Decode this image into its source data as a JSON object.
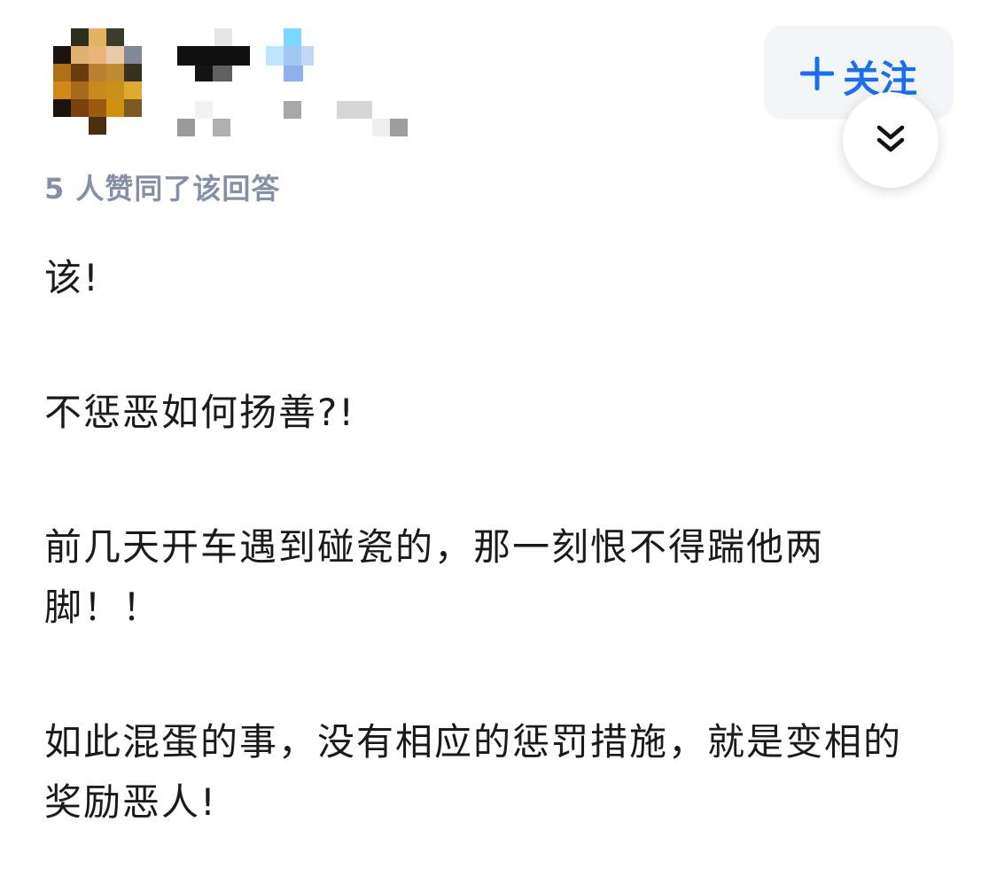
{
  "header": {
    "author_avatar": "avatar (pixelated)",
    "author_name": "",
    "follow_label": "关注",
    "follow_icon": "plus-icon",
    "collapse_icon": "double-chevron-down-icon",
    "colors": {
      "accent": "#1a6ff0",
      "meta_text": "#8590a6",
      "button_bg": "#f4f5f7"
    }
  },
  "meta": {
    "likes_text": "5 人赞同了该回答"
  },
  "answer": {
    "paragraphs": [
      "该!",
      "不惩恶如何扬善?!",
      "前几天开车遇到碰瓷的，那一刻恨不得踹他两脚！！",
      "如此混蛋的事，没有相应的惩罚措施，就是变相的奖励恶人!"
    ]
  }
}
